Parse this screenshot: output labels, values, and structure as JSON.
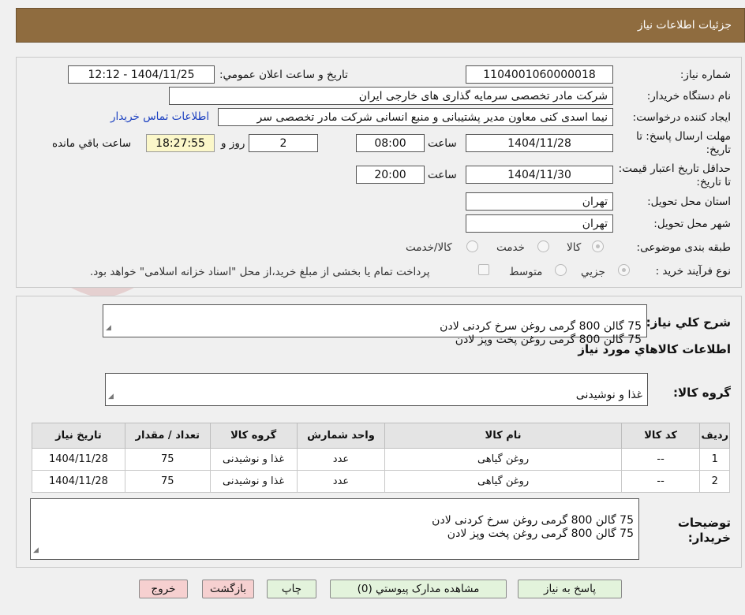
{
  "header": {
    "title": "جزئيات اطلاعات نياز"
  },
  "watermark": {
    "text": "AriaTender.neT"
  },
  "form": {
    "need_number_label": "شماره نياز:",
    "need_number": "1104001060000018",
    "announce_label": "تاريخ و ساعت اعلان عمومي:",
    "announce_value": "1404/11/25 - 12:12",
    "buyer_org_label": "نام دستگاه خريدار:",
    "buyer_org": "شرکت مادر تخصصی سرمایه گذاری های خارجی ایران",
    "requester_label": "ايجاد کننده درخواست:",
    "requester": "نیما اسدی کنی  معاون مدیر پشتیبانی و منبع انسانی شرکت مادر تخصصی سر",
    "contact_link": "اطلاعات تماس خريدار",
    "deadline_label": "مهلت ارسال پاسخ: تا تاريخ:",
    "deadline_date": "1404/11/28",
    "time_label": "ساعت",
    "deadline_time": "08:00",
    "days": "2",
    "days_label": "روز و",
    "remaining_time": "18:27:55",
    "remaining_label": "ساعت باقي مانده",
    "validity_label": "حداقل تاريخ اعتبار قيمت: تا تاريخ:",
    "validity_date": "1404/11/30",
    "validity_time_label": "ساعت",
    "validity_time": "20:00",
    "province_label": "استان محل تحويل:",
    "province": "تهران",
    "city_label": "شهر محل تحويل:",
    "city": "تهران",
    "category_label": "طبقه بندی موضوعی:",
    "category_options": [
      "کالا",
      "خدمت",
      "کالا/خدمت"
    ],
    "process_label": "نوع فرآيند خريد :",
    "process_options": [
      "جزيي",
      "متوسط"
    ],
    "process_note": "پرداخت تمام یا بخشی از مبلغ خرید،از محل \"اسناد خزانه اسلامی\" خواهد بود."
  },
  "description": {
    "label": "شرح کلي نياز:",
    "text": "75 گالن 800 گرمی روغن سرخ کردنی لادن\n75 گالن 800 گرمی روغن پخت وپز لادن"
  },
  "goods": {
    "section_title": "اطلاعات کالاهاي مورد نياز",
    "group_label": "گروه کالا:",
    "group_value": "غذا و نوشیدنی",
    "columns": [
      "رديف",
      "کد کالا",
      "نام کالا",
      "واحد شمارش",
      "گروه کالا",
      "تعداد / مقدار",
      "تاريخ نياز"
    ],
    "rows": [
      [
        "1",
        "--",
        "روغن گیاهی",
        "عدد",
        "غذا و نوشیدنی",
        "75",
        "1404/11/28"
      ],
      [
        "2",
        "--",
        "روغن گیاهی",
        "عدد",
        "غذا و نوشیدنی",
        "75",
        "1404/11/28"
      ]
    ]
  },
  "buyer_notes": {
    "label": "توضيحات خريدار:",
    "text": "75 گالن 800 گرمی روغن سرخ کردنی لادن\n75 گالن 800 گرمی روغن پخت وپز لادن"
  },
  "buttons": {
    "reply": "پاسخ به نياز",
    "attachments": "مشاهده مدارک پيوستي (0)",
    "print": "چاپ",
    "back": "بازگشت",
    "exit": "خروج"
  }
}
